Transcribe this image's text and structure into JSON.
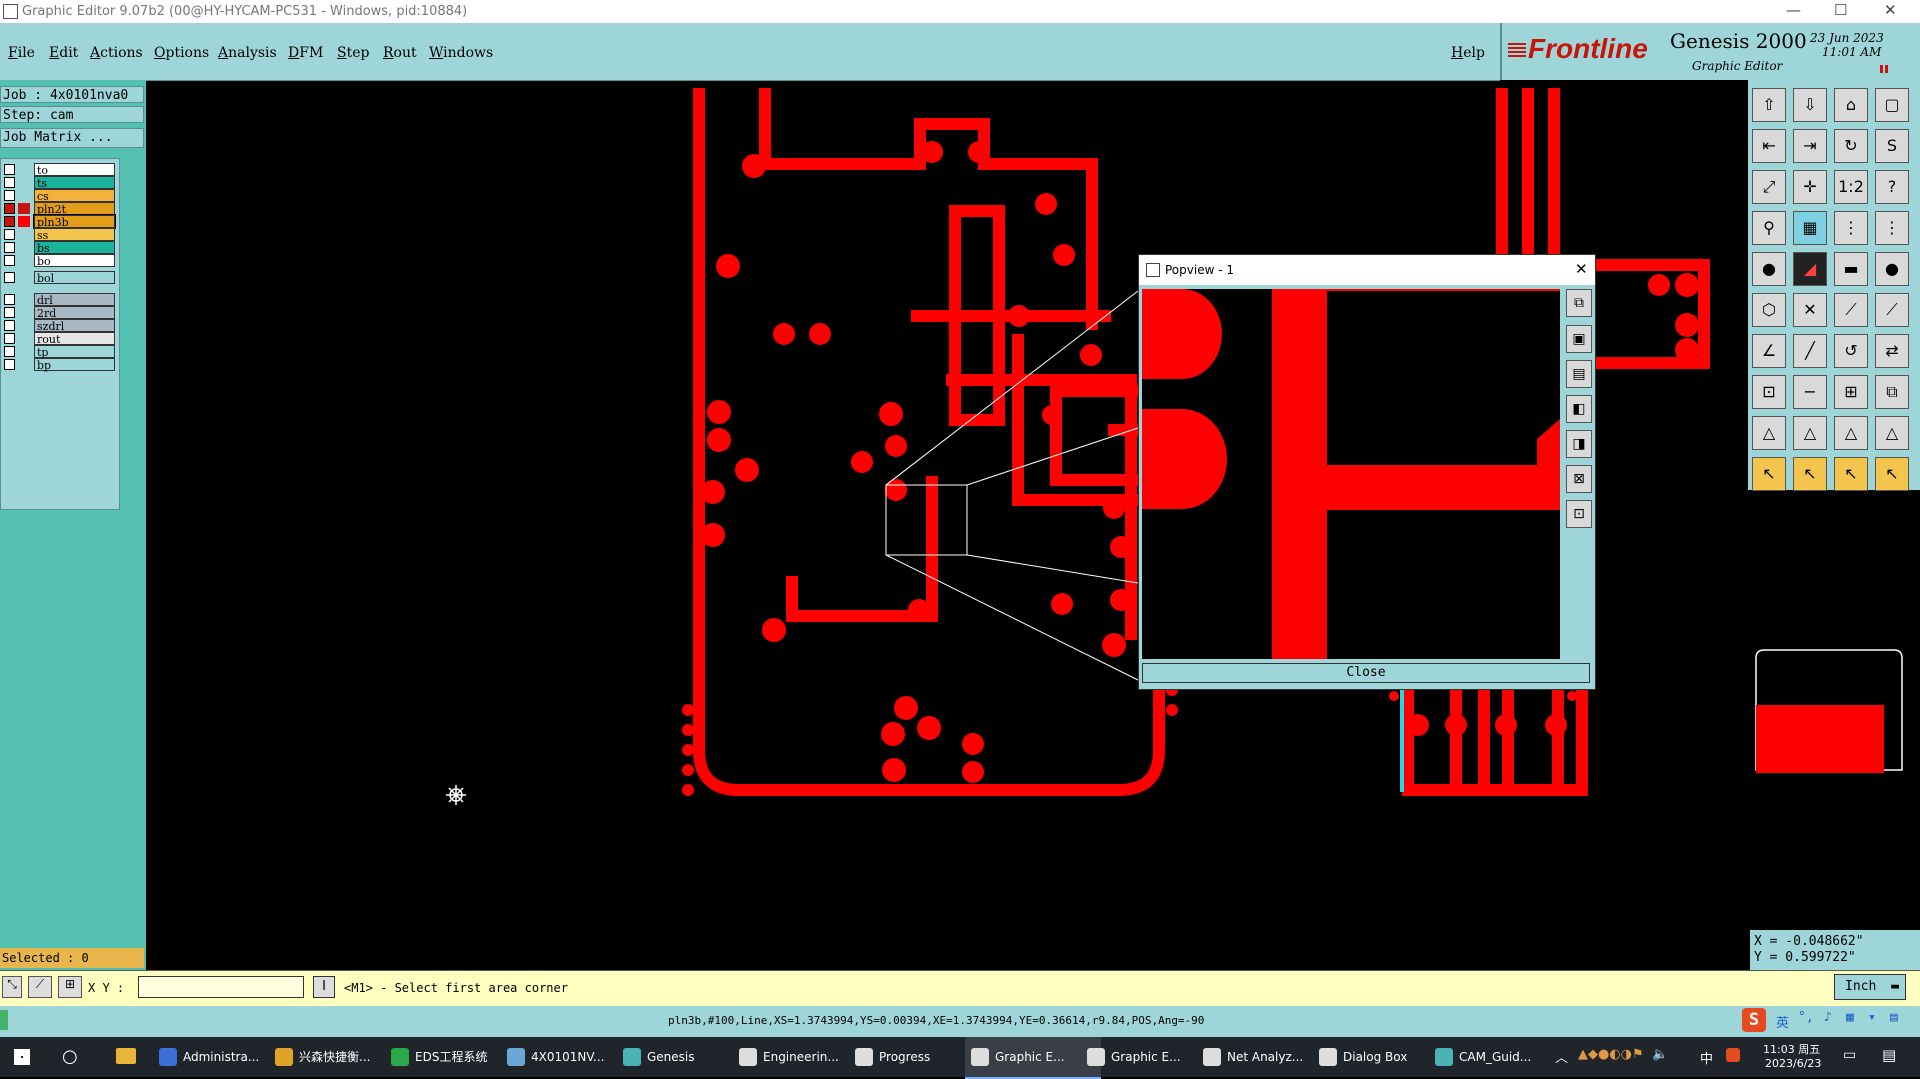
{
  "window": {
    "title": "Graphic Editor 9.07b2 (00@HY-HYCAM-PC531 - Windows, pid:10884)",
    "min": "—",
    "max": "☐",
    "close": "✕"
  },
  "menu": {
    "items": [
      "File",
      "Edit",
      "Actions",
      "Options",
      "Analysis",
      "DFM",
      "Step",
      "Rout",
      "Windows"
    ],
    "help": "Help"
  },
  "brand": {
    "logo": "Frontline",
    "product": "Genesis 2000",
    "subtitle": "Graphic Editor",
    "date": "23 Jun 2023",
    "time": "11:01 AM"
  },
  "job": {
    "job_label": "Job : 4x0101nva0",
    "step_label": "Step: cam",
    "matrix_btn": "Job Matrix ..."
  },
  "layers": [
    {
      "name": "to",
      "color": "#ffffff",
      "selected": false
    },
    {
      "name": "ts",
      "color": "#1cb39d",
      "selected": false
    },
    {
      "name": "cs",
      "color": "#f3b33a",
      "selected": false
    },
    {
      "name": "pln2t",
      "color": "#e39d18",
      "selected": true,
      "tagcolor": "#c8140a"
    },
    {
      "name": "pln3b",
      "color": "#e39d18",
      "selected": true,
      "tagcolor": "#ff0000",
      "active": true
    },
    {
      "name": "ss",
      "color": "#f3c54c",
      "selected": false
    },
    {
      "name": "bs",
      "color": "#1cb39d",
      "selected": false
    },
    {
      "name": "bo",
      "color": "#ffffff",
      "selected": false
    }
  ],
  "layers2": [
    {
      "name": "bol",
      "color": "#9ed5d8"
    }
  ],
  "layers3": [
    {
      "name": "drl",
      "color": "#a8b8c5"
    },
    {
      "name": "2rd",
      "color": "#a8b8c5"
    },
    {
      "name": "szdrl",
      "color": "#a8b8c5"
    },
    {
      "name": "rout",
      "color": "#e6e6e6"
    }
  ],
  "layers4": [
    {
      "name": "tp",
      "color": "#9ed5d8"
    },
    {
      "name": "bp",
      "color": "#9ed5d8"
    }
  ],
  "selected": "Selected : 0",
  "popview": {
    "title": "Popview - 1",
    "close_x": "✕",
    "close_btn": "Close"
  },
  "coords": {
    "x": "X = -0.048662\"",
    "y": "Y =  0.599722\""
  },
  "cmd": {
    "xy_label": "X Y :",
    "input_value": "",
    "info_icon": "I",
    "prompt": "<M1> - Select first area corner",
    "units": "Inch"
  },
  "status": "pln3b,#100,Line,XS=1.3743994,YS=0.00394,XE=1.3743994,YE=0.36614,r9.84,POS,Ang=-90",
  "taskbar": {
    "items": [
      {
        "label": "Administra...",
        "color": "#3b6fd6"
      },
      {
        "label": "兴森快捷衡...",
        "color": "#e0a32a"
      },
      {
        "label": "EDS工程系统",
        "color": "#2aa84a"
      },
      {
        "label": "4X0101NV...",
        "color": "#6aa6d6"
      },
      {
        "label": "Genesis",
        "color": "#49b3b3"
      },
      {
        "label": "Engineerin...",
        "color": "#dddddd"
      },
      {
        "label": "Progress",
        "color": "#dddddd"
      },
      {
        "label": "Graphic E...",
        "color": "#dddddd"
      },
      {
        "label": "Graphic E...",
        "color": "#dddddd"
      },
      {
        "label": "Net Analyz...",
        "color": "#dddddd"
      },
      {
        "label": "Dialog Box",
        "color": "#dddddd"
      },
      {
        "label": "CAM_Guid...",
        "color": "#49b3b3"
      }
    ],
    "tray_lang": "中",
    "tray_ime": "英",
    "clock_time": "11:03 周五",
    "clock_date": "2023/6/23"
  },
  "colors": {
    "red": "#ff0000",
    "panel": "#9ed5d8",
    "teal": "#54c0b2"
  }
}
